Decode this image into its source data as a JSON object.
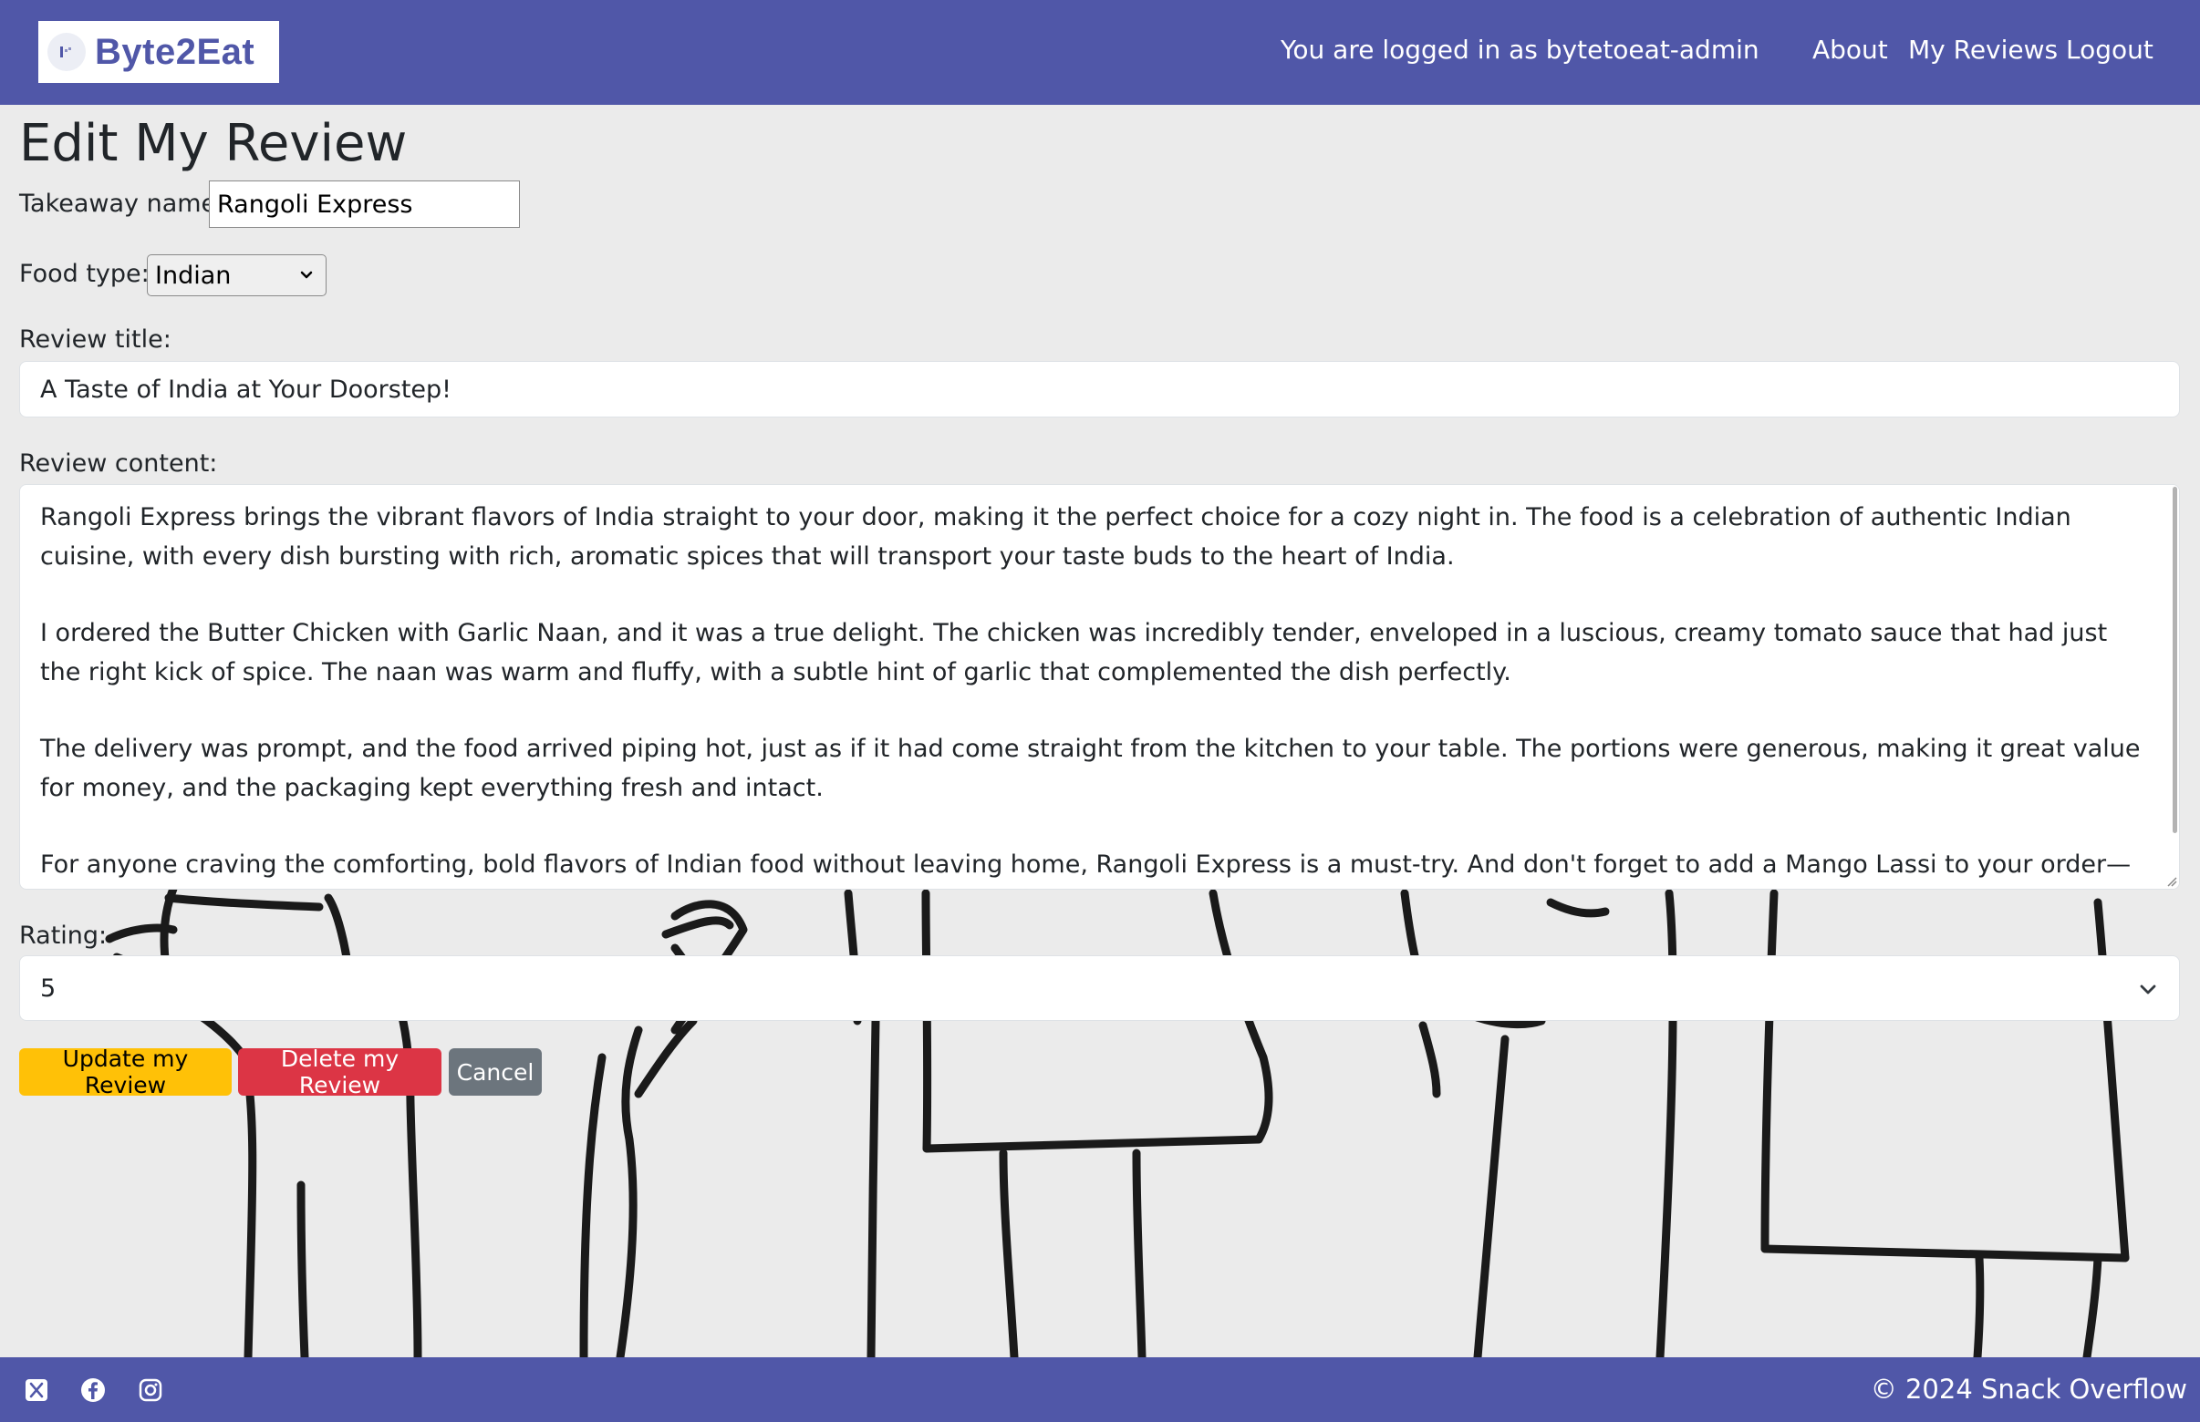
{
  "header": {
    "brand": "Byte2Eat",
    "login_status": "You are logged in as bytetoeat-admin",
    "nav": [
      "About",
      "My Reviews",
      "Logout"
    ]
  },
  "form": {
    "page_title": "Edit My Review",
    "takeaway_label": "Takeaway name:",
    "takeaway_value": "Rangoli Express",
    "food_type_label": "Food type:",
    "food_type_value": "Indian",
    "title_label": "Review title:",
    "title_value": "A Taste of India at Your Doorstep!",
    "content_label": "Review content:",
    "content_paragraphs": [
      "Rangoli Express brings the vibrant flavors of India straight to your door, making it the perfect choice for a cozy night in. The food is a celebration of authentic Indian cuisine, with every dish bursting with rich, aromatic spices that will transport your taste buds to the heart of India.",
      "I ordered the Butter Chicken with Garlic Naan, and it was a true delight. The chicken was incredibly tender, enveloped in a luscious, creamy tomato sauce that had just the right kick of spice. The naan was warm and fluffy, with a subtle hint of garlic that complemented the dish perfectly.",
      "The delivery was prompt, and the food arrived piping hot, just as if it had come straight from the kitchen to your table. The portions were generous, making it great value for money, and the packaging kept everything fresh and intact.",
      "For anyone craving the comforting, bold flavors of Indian food without leaving home, Rangoli Express is a must-try. And don't forget to add a Mango Lassi to your order—it's the perfect"
    ],
    "rating_label": "Rating:",
    "rating_value": "5",
    "buttons": {
      "update": "Update my Review",
      "delete": "Delete my Review",
      "cancel": "Cancel"
    }
  },
  "footer": {
    "social_icons": [
      "x-icon",
      "facebook-icon",
      "instagram-icon"
    ],
    "copyright": "© 2024 Snack Overflow"
  },
  "colors": {
    "brand": "#5057a8",
    "background": "#ebebeb",
    "update_button": "#ffc107",
    "delete_button": "#dc3545",
    "cancel_button": "#6c757d"
  }
}
